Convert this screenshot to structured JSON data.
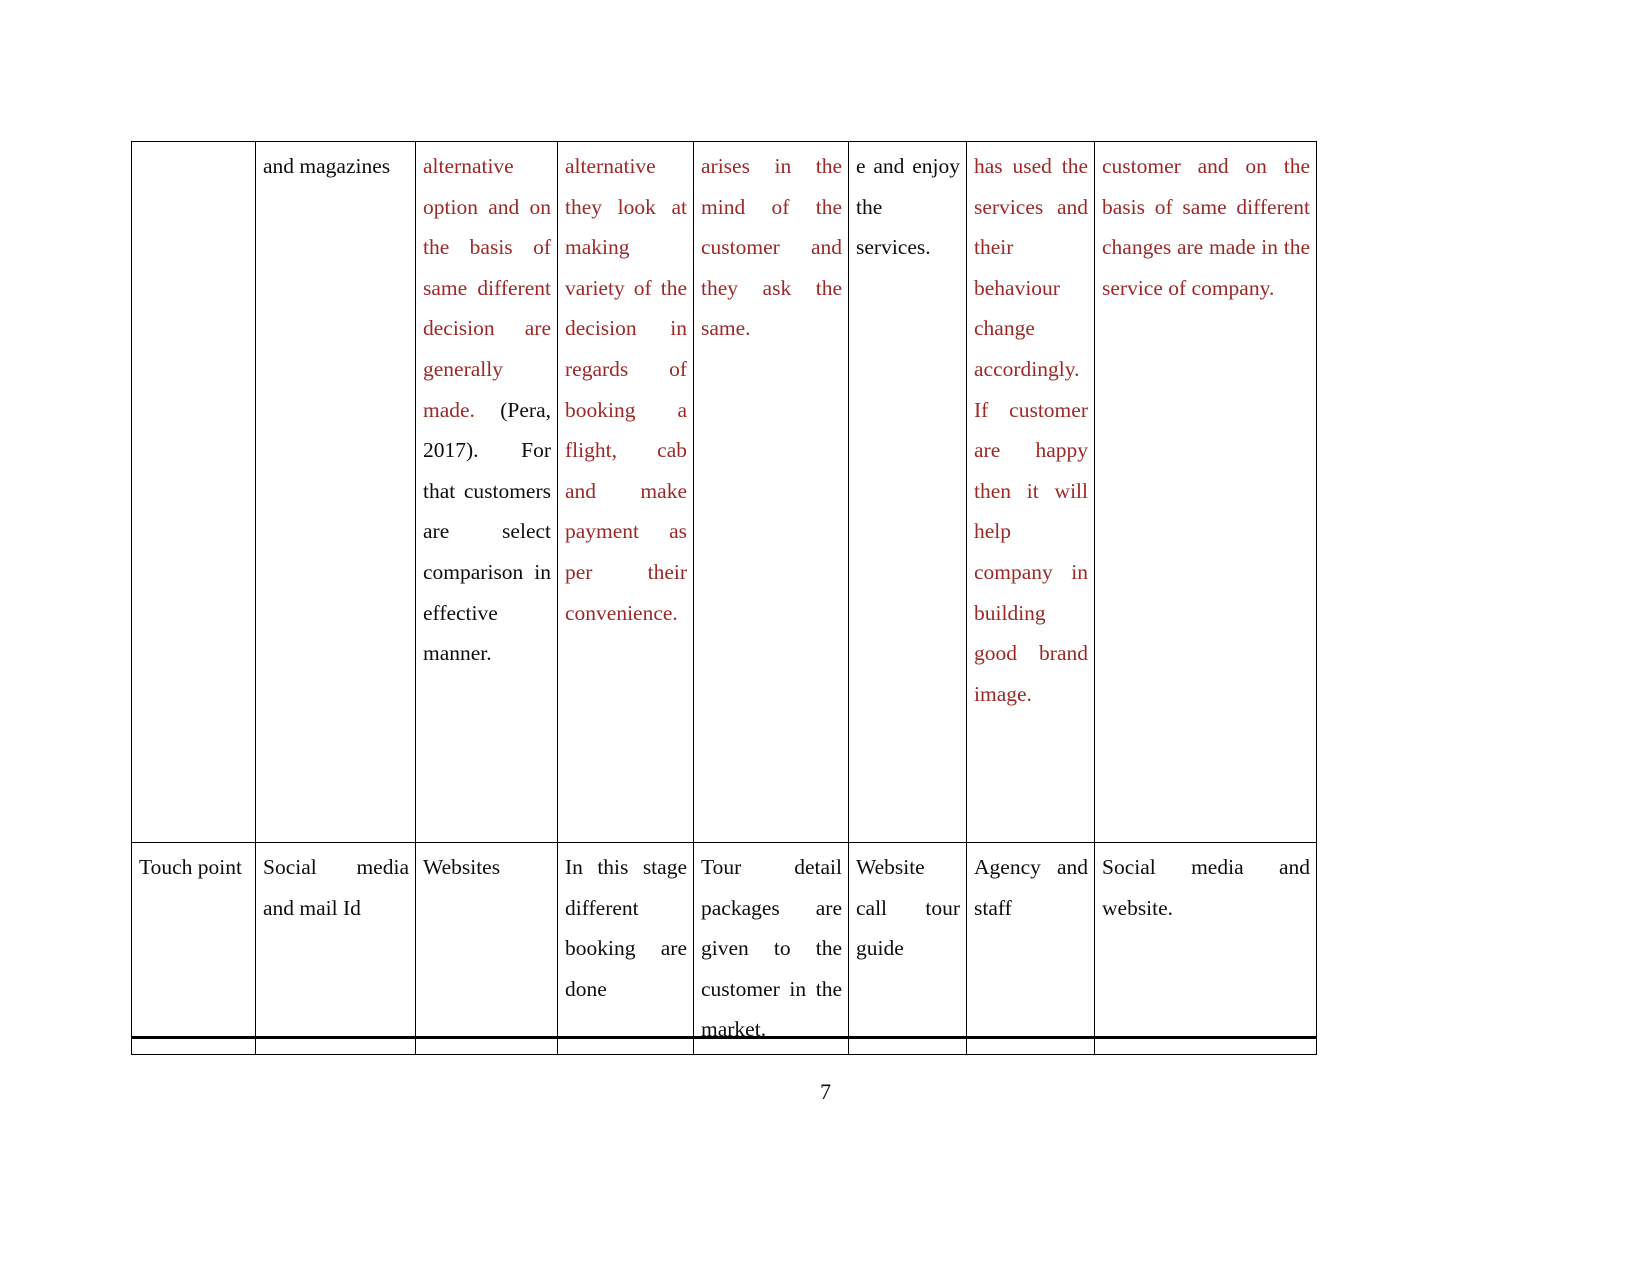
{
  "document": {
    "page_number": "7",
    "accent_color": "#9C2828",
    "text_color": "#0d0d0d"
  },
  "table": {
    "rows": [
      {
        "name": "continued-row",
        "cells": [
          {
            "name": "cell-r1-c1",
            "text": "",
            "color": "black"
          },
          {
            "name": "cell-r1-c2",
            "text": "and magazines",
            "color": "black"
          },
          {
            "name": "cell-r1-c3",
            "color": "mixed",
            "segments": [
              {
                "text": "alternative option and on the basis of same different decision are generally made. ",
                "color": "red"
              },
              {
                "text": "(Pera, 2017). For that customers are select comparison in effective manner.",
                "color": "black"
              }
            ]
          },
          {
            "name": "cell-r1-c4",
            "text": "alternative they look at making variety of the decision in regards of booking a flight, cab and make payment as per their convenience.",
            "color": "red"
          },
          {
            "name": "cell-r1-c5",
            "text": "arises in the mind of the customer and they ask the same.",
            "color": "red"
          },
          {
            "name": "cell-r1-c6",
            "text": "e and enjoy the services.",
            "color": "black"
          },
          {
            "name": "cell-r1-c7",
            "text": "has used the services and their behaviour change accordingly. If customer are happy then it will help company in building good brand image.",
            "color": "red"
          },
          {
            "name": "cell-r1-c8",
            "text": "customer and on the basis of same different changes are made in the service of company.",
            "color": "red"
          }
        ]
      },
      {
        "name": "touch-point-row",
        "cells": [
          {
            "name": "cell-r2-c1",
            "text": "Touch point",
            "color": "black"
          },
          {
            "name": "cell-r2-c2",
            "text": "Social media and mail Id",
            "color": "black"
          },
          {
            "name": "cell-r2-c3",
            "text": "Websites",
            "color": "black"
          },
          {
            "name": "cell-r2-c4",
            "text": "In this stage different booking are done",
            "color": "black"
          },
          {
            "name": "cell-r2-c5",
            "text": "Tour detail packages are given to the customer in the market.",
            "color": "black"
          },
          {
            "name": "cell-r2-c6",
            "text": "Website call tour guide",
            "color": "black"
          },
          {
            "name": "cell-r2-c7",
            "text": "Agency and staff",
            "color": "black"
          },
          {
            "name": "cell-r2-c8",
            "text": "Social media and website.",
            "color": "black"
          }
        ]
      }
    ]
  }
}
